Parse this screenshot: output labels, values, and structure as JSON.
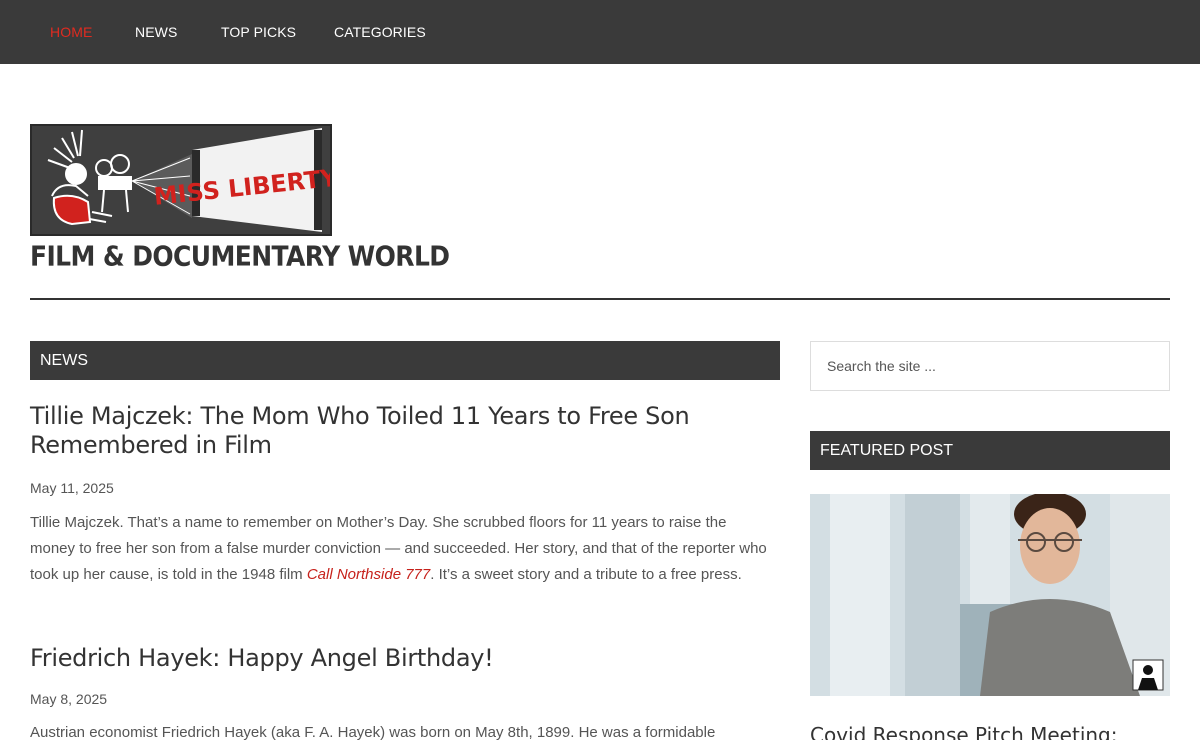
{
  "nav": {
    "items": [
      {
        "label": "HOME",
        "active": true
      },
      {
        "label": "NEWS"
      },
      {
        "label": "TOP PICKS"
      },
      {
        "label": "CATEGORIES"
      }
    ]
  },
  "logo": {
    "banner_text": "MISS LIBERTY'S",
    "subtitle": "FILM & DOCUMENTARY WORLD"
  },
  "main": {
    "section_title": "NEWS",
    "posts": [
      {
        "title": "Tillie Majczek: The Mom Who Toiled 11 Years to Free Son Remembered in Film",
        "date": "May 11, 2025",
        "excerpt_before": "Tillie Majczek. That’s a name to remember on Mother’s Day. She scrubbed floors for 11 years to raise the money to free her son from a false murder conviction — and succeeded. Her story, and that of the reporter who took up her cause, is told in the 1948 film ",
        "excerpt_link": "Call Northside 777",
        "excerpt_after": ". It’s a sweet story and a tribute to a free press."
      },
      {
        "title": "Friedrich Hayek: Happy Angel Birthday!",
        "date": "May 8, 2025",
        "excerpt_before": "Austrian economist Friedrich Hayek (aka F. A. Hayek) was born on May 8th, 1899. He was a formidable"
      }
    ]
  },
  "sidebar": {
    "search_placeholder": "Search the site ...",
    "featured_title": "FEATURED POST",
    "featured_post_title": "Covid Response Pitch Meeting:"
  },
  "colors": {
    "nav_bg": "#3a3a3a",
    "accent": "#e02b20",
    "link": "#c6211b"
  }
}
